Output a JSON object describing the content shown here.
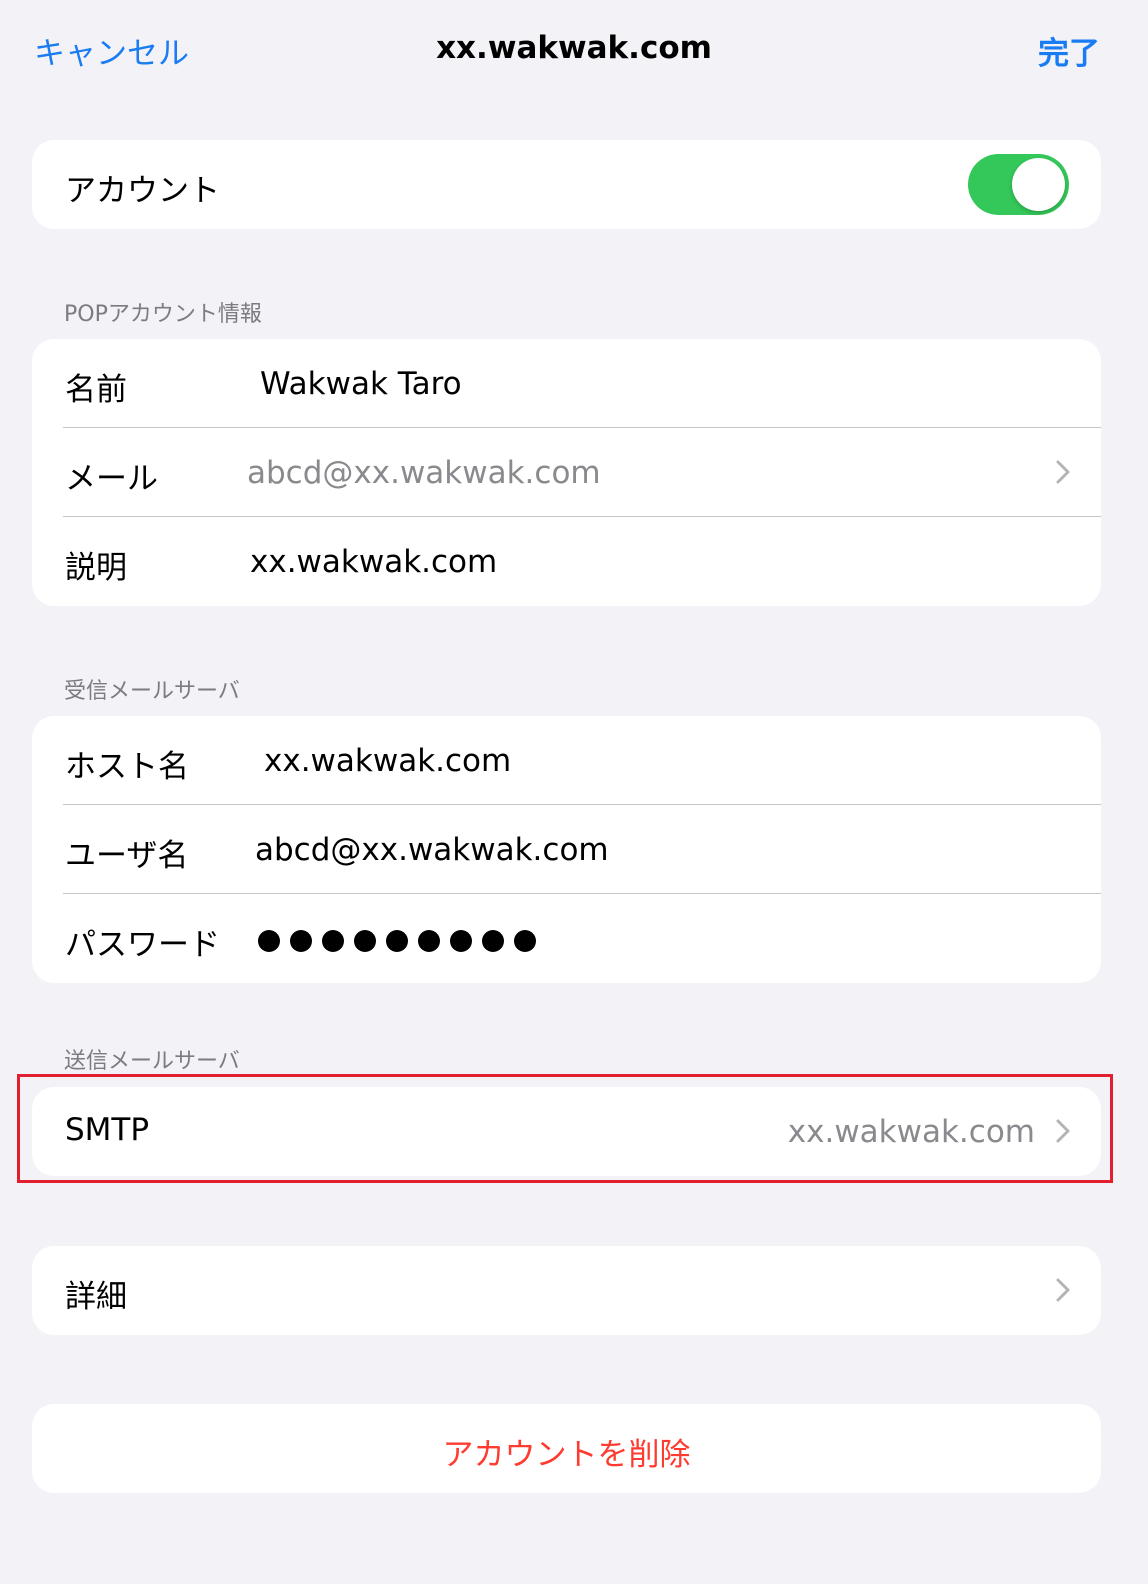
{
  "nav": {
    "cancel": "キャンセル",
    "title": "xx.wakwak.com",
    "done": "完了"
  },
  "account_toggle": {
    "label": "アカウント",
    "state": "on"
  },
  "pop_section": {
    "header": "POPアカウント情報",
    "rows": [
      {
        "label": "名前",
        "value": "Wakwak Taro"
      },
      {
        "label": "メール",
        "value": "abcd@xx.wakwak.com"
      },
      {
        "label": "説明",
        "value": "xx.wakwak.com"
      }
    ]
  },
  "incoming_section": {
    "header": "受信メールサーバ",
    "rows": [
      {
        "label": "ホスト名",
        "value": "xx.wakwak.com"
      },
      {
        "label": "ユーザ名",
        "value": "abcd@xx.wakwak.com"
      },
      {
        "label": "パスワード",
        "value_masked_count": 9
      }
    ]
  },
  "outgoing_section": {
    "header": "送信メールサーバ",
    "smtp": {
      "label": "SMTP",
      "value": "xx.wakwak.com"
    }
  },
  "advanced": {
    "label": "詳細"
  },
  "delete_account": {
    "label": "アカウントを削除"
  },
  "colors": {
    "accent": "#1a7cf2",
    "toggle_on": "#34c759",
    "destructive": "#ff3b30",
    "highlight": "#e0202e",
    "background": "#f2f2f7"
  }
}
